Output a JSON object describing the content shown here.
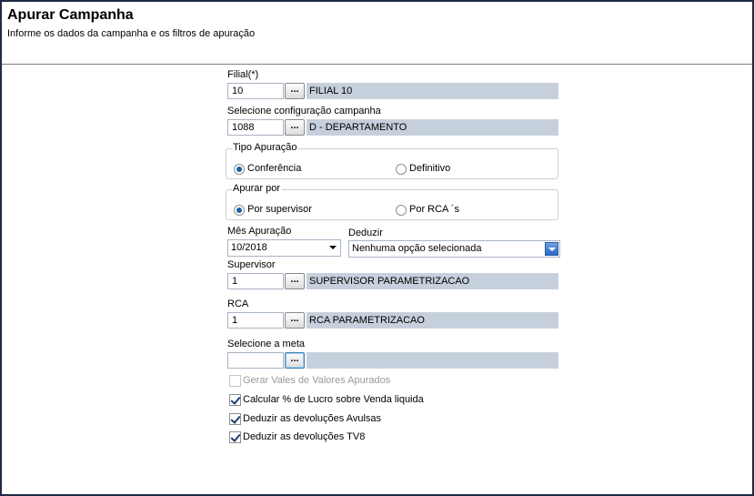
{
  "header": {
    "title": "Apurar Campanha",
    "subtitle": "Informe os dados da campanha e os filtros de apuração"
  },
  "filial": {
    "label": "Filial(*)",
    "code": "10",
    "button": "...",
    "description": "FILIAL 10"
  },
  "config": {
    "label": "Selecione configuração campanha",
    "code": "1088",
    "button": "...",
    "description": "D - DEPARTAMENTO"
  },
  "tipo_apuracao": {
    "title": "Tipo Apuração",
    "options": [
      {
        "label": "Conferência",
        "selected": true
      },
      {
        "label": "Definitivo",
        "selected": false
      }
    ]
  },
  "apurar_por": {
    "title": "Apurar por",
    "options": [
      {
        "label": "Por supervisor",
        "selected": true
      },
      {
        "label": "Por RCA ´s",
        "selected": false
      }
    ]
  },
  "mes_apuracao": {
    "label": "Mês Apuração",
    "value": "10/2018"
  },
  "deduzir": {
    "label": "Deduzir",
    "value": "Nenhuma opção selecionada"
  },
  "supervisor": {
    "label": "Supervisor",
    "code": "1",
    "button": "...",
    "description": "SUPERVISOR PARAMETRIZACAO"
  },
  "rca": {
    "label": "RCA",
    "code": "1",
    "button": "...",
    "description": "RCA PARAMETRIZACAO"
  },
  "meta": {
    "label": "Selecione a meta",
    "code": "",
    "button": "...",
    "description": ""
  },
  "checks": [
    {
      "label": "Gerar Vales de Valores Apurados",
      "checked": false,
      "enabled": false
    },
    {
      "label": "Calcular % de Lucro sobre Venda liquida",
      "checked": true,
      "enabled": true
    },
    {
      "label": "Deduzir as devoluções Avulsas",
      "checked": true,
      "enabled": true
    },
    {
      "label": "Deduzir as devoluções TV8",
      "checked": true,
      "enabled": true
    }
  ],
  "colors": {
    "frame": "#1f2a44",
    "desc_bg": "#c6d0dc",
    "accent": "#2c66c6"
  }
}
